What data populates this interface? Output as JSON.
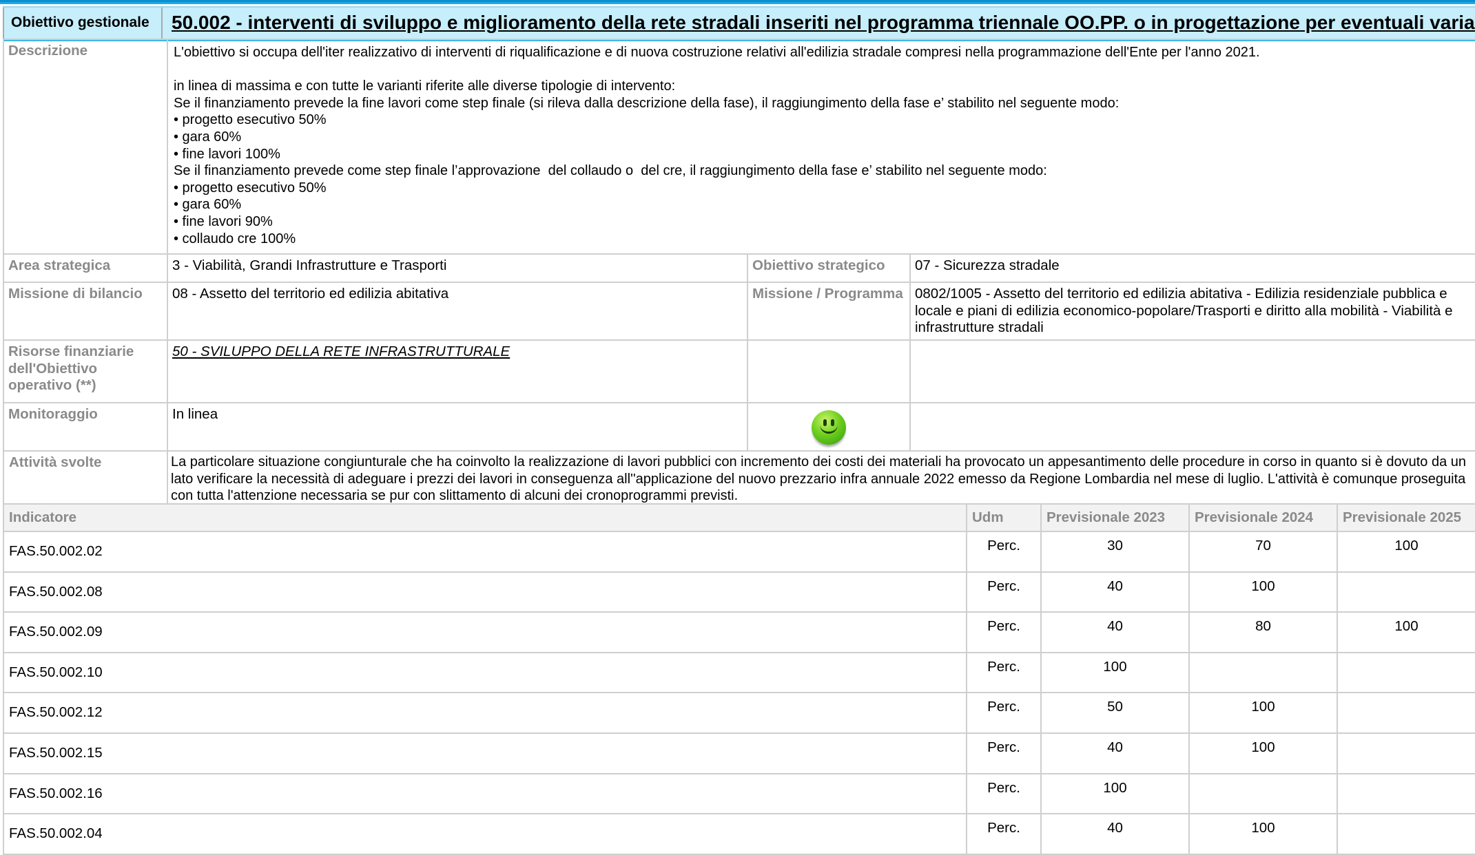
{
  "header": {
    "label": "Obiettivo gestionale",
    "title": "50.002 - interventi di sviluppo e miglioramento della rete stradali inseriti nel programma triennale OO.PP. o in progettazione per eventuali variazioni"
  },
  "descrizione": {
    "label": "Descrizione",
    "lines": [
      "L'obiettivo si occupa dell'iter realizzativo di interventi di riqualificazione e di nuova costruzione relativi all'edilizia stradale compresi nella programmazione dell'Ente per l'anno 2021.",
      " ",
      "in linea di massima e con tutte le varianti riferite alle diverse tipologie di intervento:",
      "Se il finanziamento prevede la fine lavori come step finale (si rileva dalla descrizione della fase), il raggiungimento della fase e’ stabilito nel seguente modo:",
      "• progetto esecutivo 50%",
      "• gara 60%",
      "• fine lavori 100%",
      "Se il finanziamento prevede come step finale l’approvazione  del collaudo o  del cre, il raggiungimento della fase e’ stabilito nel seguente modo:",
      "• progetto esecutivo 50%",
      "• gara 60%",
      "• fine lavori 90%",
      "• collaudo cre 100%"
    ]
  },
  "area": {
    "label": "Area strategica",
    "value": "3 - Viabilità, Grandi Infrastrutture e Trasporti",
    "obj_label": "Obiettivo strategico",
    "obj_value": "07 - Sicurezza stradale"
  },
  "missione": {
    "label": "Missione di bilancio",
    "value": "08 - Assetto del territorio ed edilizia abitativa",
    "prog_label": "Missione / Programma",
    "prog_value": "0802/1005 - Assetto del territorio ed edilizia abitativa - Edilizia residenziale pubblica e locale e piani di edilizia economico-popolare/Trasporti e diritto alla mobilità - Viabilità e infrastrutture stradali"
  },
  "risorse": {
    "label": "Risorse finanziarie dell'Obiettivo operativo (**)",
    "value": "50 - SVILUPPO DELLA RETE INFRASTRUTTURALE"
  },
  "monitoraggio": {
    "label": "Monitoraggio",
    "value": "In linea",
    "status_icon": "green-smiley-icon"
  },
  "attivita": {
    "label": "Attività svolte",
    "value": "La particolare situazione congiunturale che ha coinvolto la realizzazione di lavori pubblici con incremento dei costi dei materiali ha provocato un appesantimento delle procedure in corso in quanto si è dovuto da un lato verificare la necessità di adeguare i prezzi dei lavori in conseguenza  all''applicazione del nuovo prezzario infra annuale 2022 emesso da Regione Lombardia nel mese di luglio. L'attività è comunque proseguita con tutta l'attenzione necessaria se pur con slittamento di alcuni dei cronoprogrammi previsti."
  },
  "indicatori": {
    "headers": [
      "Indicatore",
      "Udm",
      "Previsionale 2023",
      "Previsionale 2024",
      "Previsionale 2025"
    ],
    "rows": [
      [
        "FAS.50.002.02",
        "Perc.",
        "30",
        "70",
        "100"
      ],
      [
        "FAS.50.002.08",
        "Perc.",
        "40",
        "100",
        ""
      ],
      [
        "FAS.50.002.09",
        "Perc.",
        "40",
        "80",
        "100"
      ],
      [
        "FAS.50.002.10",
        "Perc.",
        "100",
        "",
        ""
      ],
      [
        "FAS.50.002.12",
        "Perc.",
        "50",
        "100",
        ""
      ],
      [
        "FAS.50.002.15",
        "Perc.",
        "40",
        "100",
        ""
      ],
      [
        "FAS.50.002.16",
        "Perc.",
        "100",
        "",
        ""
      ],
      [
        "FAS.50.002.04",
        "Perc.",
        "40",
        "100",
        ""
      ]
    ]
  }
}
